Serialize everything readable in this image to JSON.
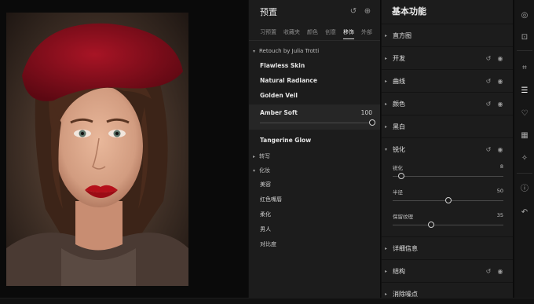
{
  "presets_panel": {
    "title": "预置",
    "tabs": [
      "习预置",
      "收藏夹",
      "颜色",
      "创意",
      "移饰",
      "外部"
    ],
    "active_tab_index": 4,
    "groups": [
      {
        "name": "Retouch by Julia Trotti",
        "expanded": true,
        "items": [
          "Flawless Skin",
          "Natural Radiance",
          "Golden Veil",
          "Amber Soft",
          "Tangerine Glow"
        ]
      },
      {
        "name": "转写",
        "expanded": false
      },
      {
        "name": "化妆",
        "expanded": true,
        "items": [
          "美容",
          "红色嘴唇",
          "柔化",
          "男人",
          "对比度"
        ]
      }
    ],
    "selected_preset": {
      "name": "Amber Soft",
      "amount": 100,
      "amount_fraction": 1.0
    }
  },
  "adjust_panel": {
    "title": "基本功能",
    "sections": [
      {
        "label": "直方图",
        "expanded": false,
        "has_reset": false,
        "has_eye": false
      },
      {
        "label": "开发",
        "expanded": false,
        "has_reset": true,
        "has_eye": true
      },
      {
        "label": "曲线",
        "expanded": false,
        "has_reset": true,
        "has_eye": true
      },
      {
        "label": "颜色",
        "expanded": false,
        "has_reset": true,
        "has_eye": true
      },
      {
        "label": "黑白",
        "expanded": false,
        "has_reset": false,
        "has_eye": false
      },
      {
        "label": "锐化",
        "expanded": true,
        "has_reset": true,
        "has_eye": true
      },
      {
        "label": "详细信息",
        "expanded": false,
        "has_reset": false,
        "has_eye": false
      },
      {
        "label": "结构",
        "expanded": false,
        "has_reset": true,
        "has_eye": true
      },
      {
        "label": "消除噪点",
        "expanded": false,
        "has_reset": false,
        "has_eye": false
      }
    ],
    "sharpen_sliders": [
      {
        "label": "锐化",
        "value": "8",
        "fraction": 0.08
      },
      {
        "label": "半径",
        "value": "50",
        "fraction": 0.5
      },
      {
        "label": "保留纹理",
        "value": "35",
        "fraction": 0.35
      }
    ]
  },
  "tools": [
    {
      "name": "presets-tool",
      "glyph": "◎"
    },
    {
      "name": "mask-tool",
      "glyph": "⊡"
    },
    {
      "name": "crop-tool",
      "glyph": "⌗"
    },
    {
      "name": "adjust-tool",
      "glyph": "☰"
    },
    {
      "name": "heal-tool",
      "glyph": "♡"
    },
    {
      "name": "grid-tool",
      "glyph": "▦"
    },
    {
      "name": "ai-tool",
      "glyph": "✧"
    },
    {
      "name": "info-tool",
      "glyph": "ⓘ"
    },
    {
      "name": "undo-tool",
      "glyph": "↶"
    }
  ],
  "icons": {
    "reset": "↺",
    "eye": "◉",
    "refresh": "↺",
    "add": "⊕",
    "triangle_right": "▸",
    "triangle_down": "▾"
  },
  "colors": {
    "panel_bg": "#1c1c1c",
    "accent": "#ffffff",
    "lip_red": "#b5101a",
    "beret_red": "#8e0d1c"
  }
}
